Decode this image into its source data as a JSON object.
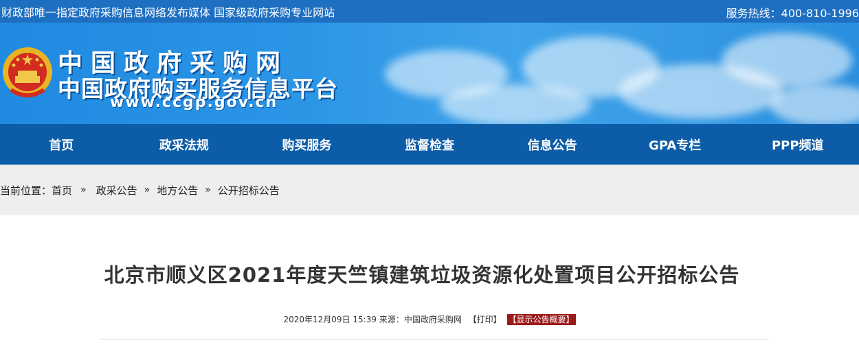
{
  "topbar": {
    "slogan": "财政部唯一指定政府采购信息网络发布媒体  国家级政府采购专业网站",
    "hotline": "服务热线：400-810-1996"
  },
  "banner": {
    "title_line1": "中国政府采购网",
    "title_line2": "中国政府购买服务信息平台",
    "website": "www.ccgp.gov.cn"
  },
  "nav": {
    "items": [
      {
        "label": "首页"
      },
      {
        "label": "政采法规"
      },
      {
        "label": "购买服务"
      },
      {
        "label": "监督检查"
      },
      {
        "label": "信息公告"
      },
      {
        "label": "GPA专栏"
      },
      {
        "label": "PPP频道"
      }
    ]
  },
  "breadcrumb": {
    "prefix": "当前位置：",
    "items": [
      "首页",
      "政采公告",
      "地方公告",
      "公开招标公告"
    ],
    "separator": "»"
  },
  "article": {
    "title": "北京市顺义区2021年度天竺镇建筑垃圾资源化处置项目公开招标公告",
    "datetime": "2020年12月09日 15:39",
    "source_label": "来源：",
    "source": "中国政府采购网",
    "print_label": "【打印】",
    "summary_label": "【显示公告概要】"
  },
  "colors": {
    "topbar_bg": "#1e6fc1",
    "nav_bg": "#0d5ca8",
    "crumb_bg": "#eeeeee",
    "summary_bg": "#9b1b1b"
  }
}
